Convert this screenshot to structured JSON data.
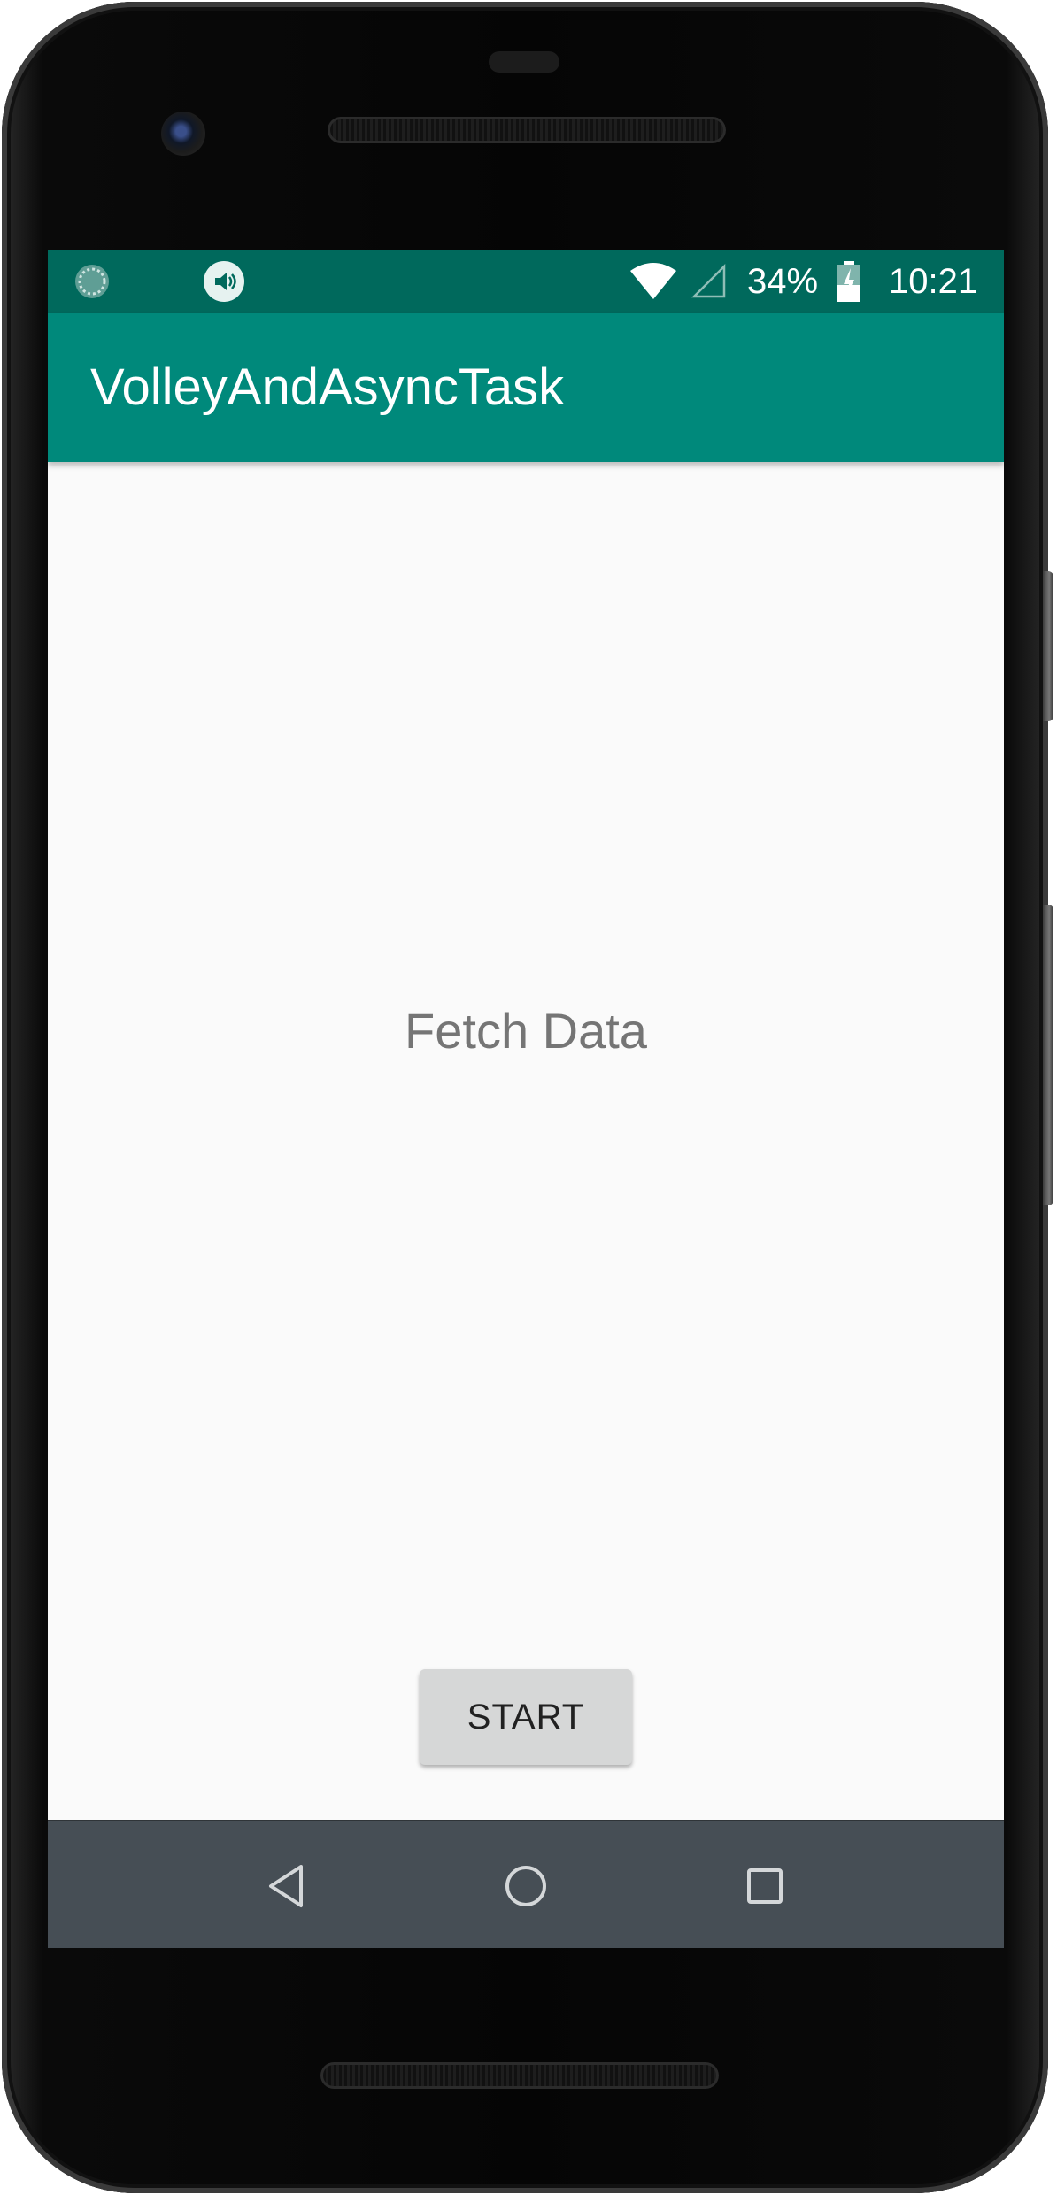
{
  "status_bar": {
    "battery_percent": "34%",
    "time": "10:21",
    "icons": [
      "sync-icon",
      "volume-icon",
      "wifi-icon",
      "cell-signal-icon",
      "battery-icon"
    ]
  },
  "app_bar": {
    "title": "VolleyAndAsyncTask"
  },
  "main": {
    "message": "Fetch Data",
    "start_button_label": "START"
  },
  "nav_bar": {
    "icons": [
      "back-icon",
      "home-icon",
      "recents-icon"
    ]
  },
  "colors": {
    "status_bar": "#00695c",
    "app_bar": "#00897b",
    "background": "#fafafa",
    "message_text": "#757575",
    "button_bg": "#d6d7d7",
    "nav_bar": "#464e55"
  }
}
